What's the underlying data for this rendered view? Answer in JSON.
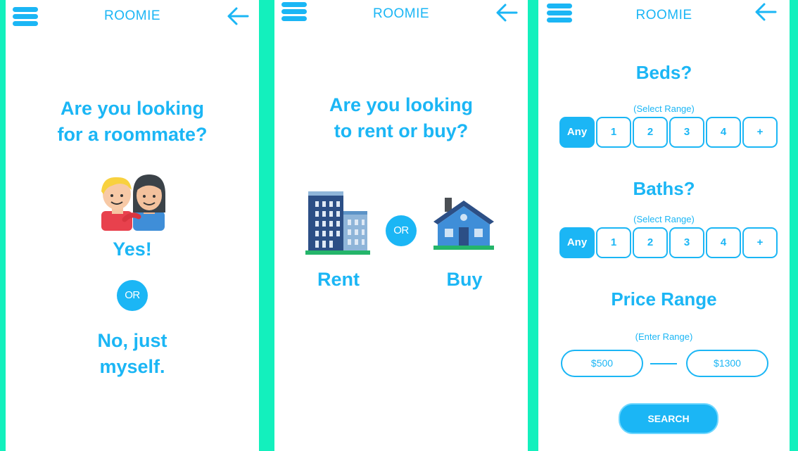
{
  "app": {
    "logo": "ROOMIE",
    "icons": {
      "menu": "hamburger-menu-icon",
      "back": "back-arrow-icon"
    }
  },
  "colors": {
    "accent": "#1bb6f5",
    "background": "#13f0bd",
    "panel": "#ffffff"
  },
  "screen1": {
    "question_line1": "Are you looking",
    "question_line2": "for a roommate?",
    "illustration": "roommates-icon",
    "yes_label": "Yes!",
    "or_label": "OR",
    "no_line1": "No, just",
    "no_line2": "myself."
  },
  "screen2": {
    "question_line1": "Are you looking",
    "question_line2": "to rent or buy?",
    "rent_icon": "apartment-building-icon",
    "buy_icon": "house-icon",
    "or_label": "OR",
    "rent_label": "Rent",
    "buy_label": "Buy"
  },
  "screen3": {
    "beds": {
      "title": "Beds?",
      "hint": "(Select Range)",
      "options": [
        "Any",
        "1",
        "2",
        "3",
        "4",
        "+"
      ],
      "selected": "Any"
    },
    "baths": {
      "title": "Baths?",
      "hint": "(Select Range)",
      "options": [
        "Any",
        "1",
        "2",
        "3",
        "4",
        "+"
      ],
      "selected": "Any"
    },
    "price": {
      "title": "Price Range",
      "hint": "(Enter Range)",
      "min": "$500",
      "max": "$1300"
    },
    "search_label": "SEARCH"
  }
}
